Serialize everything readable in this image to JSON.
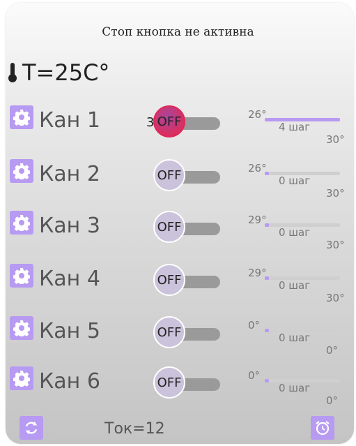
{
  "header": {
    "title": "Стоп кнопка не активна",
    "temperature": "T=25C°"
  },
  "channels": [
    {
      "label": "Кан 1",
      "state": "OFF",
      "extra": "3",
      "on": true,
      "t_from": "26°",
      "steps": "4 шаг",
      "t_to": "30°",
      "progress": 1.0
    },
    {
      "label": "Кан 2",
      "state": "OFF",
      "extra": "",
      "on": false,
      "t_from": "26°",
      "steps": "0 шаг",
      "t_to": "30°",
      "progress": 0.06
    },
    {
      "label": "Кан 3",
      "state": "OFF",
      "extra": "",
      "on": false,
      "t_from": "29°",
      "steps": "0 шаг",
      "t_to": "30°",
      "progress": 0.06
    },
    {
      "label": "Кан 4",
      "state": "OFF",
      "extra": "",
      "on": false,
      "t_from": "29°",
      "steps": "0 шаг",
      "t_to": "30°",
      "progress": 0.06
    },
    {
      "label": "Кан 5",
      "state": "OFF",
      "extra": "",
      "on": false,
      "t_from": "0°",
      "steps": "0 шаг",
      "t_to": "0°",
      "progress": 0.06
    },
    {
      "label": "Кан 6",
      "state": "OFF",
      "extra": "",
      "on": false,
      "t_from": "0°",
      "steps": "0 шаг",
      "t_to": "0°",
      "progress": 0.06
    }
  ],
  "footer": {
    "current": "Ток=12",
    "refresh_icon": "refresh-icon",
    "alarm_icon": "alarm-clock-icon"
  },
  "colors": {
    "accent": "#b79af2",
    "toggle_on": "#e0285a",
    "toggle_off": "#cbc2db"
  }
}
